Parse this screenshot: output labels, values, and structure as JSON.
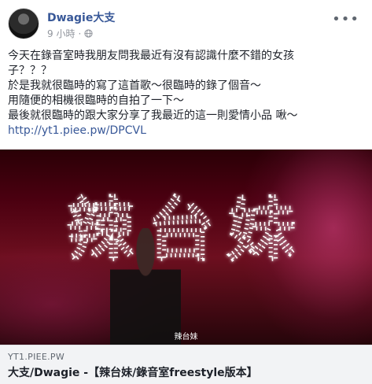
{
  "post": {
    "author": "Dwagie大支",
    "timestamp": "9 小時",
    "separator": "·",
    "privacy_icon": "globe-icon",
    "more_icon": "more-options-icon",
    "text_lines": [
      "今天在錄音室時我朋友問我最近有沒有認識什麼不錯的女孩",
      "子？？？",
      "於是我就很臨時的寫了這首歌～很臨時的錄了個音～",
      "用隨便的相機很臨時的自拍了一下～",
      "最後就很臨時的跟大家分享了我最近的這一則愛情小品 啾～"
    ],
    "link_text": "http://yt1.piee.pw/DPCVL"
  },
  "media": {
    "overlay_title": "辣台妹",
    "caption": "辣台妹"
  },
  "link_preview": {
    "domain": "YT1.PIEE.PW",
    "title": "大支/Dwagie -【辣台妹/錄音室freestyle版本】"
  }
}
